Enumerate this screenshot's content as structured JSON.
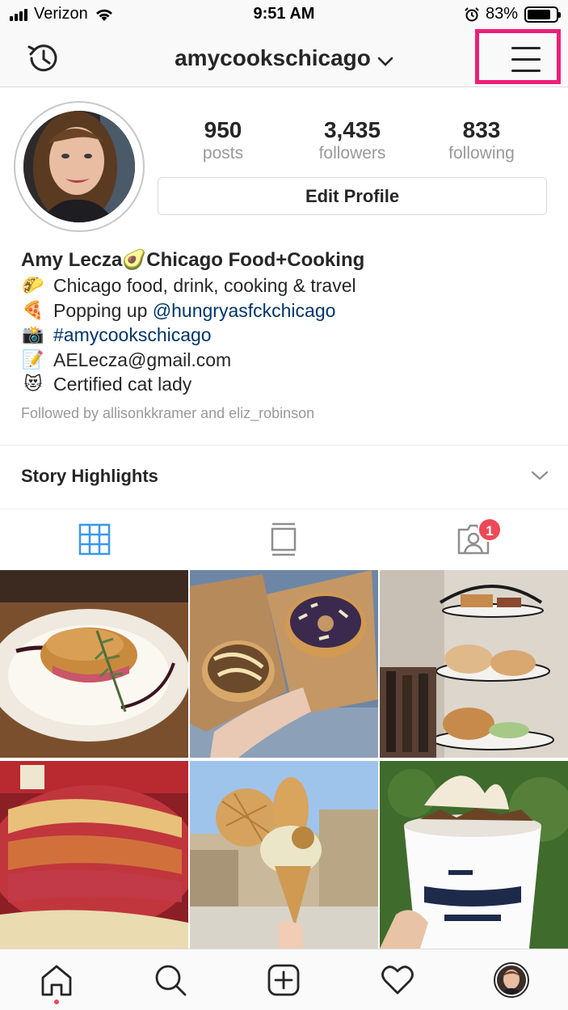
{
  "status_bar": {
    "carrier": "Verizon",
    "time": "9:51 AM",
    "battery": "83%",
    "battery_level": 0.83
  },
  "header": {
    "username": "amycookschicago"
  },
  "profile": {
    "stats": [
      {
        "value": "950",
        "label": "posts"
      },
      {
        "value": "3,435",
        "label": "followers"
      },
      {
        "value": "833",
        "label": "following"
      }
    ],
    "edit_profile_label": "Edit Profile"
  },
  "bio": {
    "name": "Amy Lecza🥑Chicago Food+Cooking",
    "lines": [
      {
        "emoji": "🌮",
        "text": "Chicago food, drink, cooking & travel"
      },
      {
        "emoji": "🍕",
        "prefix": "Popping up ",
        "link": "@hungryasfckchicago"
      },
      {
        "emoji": "📸",
        "link": "#amycookschicago"
      },
      {
        "emoji": "📝",
        "text": "AELecza@gmail.com"
      },
      {
        "emoji": "😻",
        "text": "Certified cat lady"
      }
    ],
    "followed_by": "Followed by allisonkkramer and eliz_robinson"
  },
  "highlights": {
    "title": "Story Highlights"
  },
  "tabs": {
    "tagged_badge": "1"
  },
  "colors": {
    "accent_blue": "#3897f0",
    "badge_red": "#ed4956",
    "highlight_pink": "#ed1e79",
    "link": "#003569"
  },
  "icons": {
    "history": "history-icon",
    "menu": "hamburger-menu-icon",
    "grid": "grid-icon",
    "feed": "feed-icon",
    "tagged": "tagged-icon",
    "home": "home-icon",
    "search": "search-icon",
    "add": "add-post-icon",
    "activity": "heart-icon"
  }
}
